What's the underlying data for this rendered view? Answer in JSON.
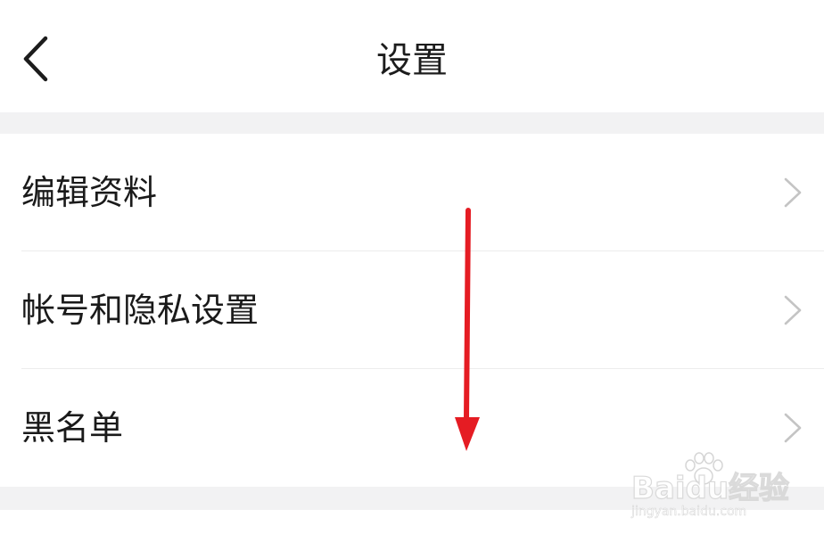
{
  "header": {
    "title": "设置",
    "back_icon": "chevron-left-icon"
  },
  "settings": {
    "items": [
      {
        "label": "编辑资料",
        "icon": "chevron-right-icon"
      },
      {
        "label": "帐号和隐私设置",
        "icon": "chevron-right-icon"
      },
      {
        "label": "黑名单",
        "icon": "chevron-right-icon"
      }
    ]
  },
  "annotation": {
    "arrow_color": "#e51c23",
    "direction": "down"
  },
  "watermark": {
    "logo_text": "Baidu经验",
    "url": "jingyan.baidu.com"
  },
  "colors": {
    "background": "#f2f2f3",
    "surface": "#ffffff",
    "text": "#1a1a1a",
    "chevron": "#c4c4c4"
  }
}
